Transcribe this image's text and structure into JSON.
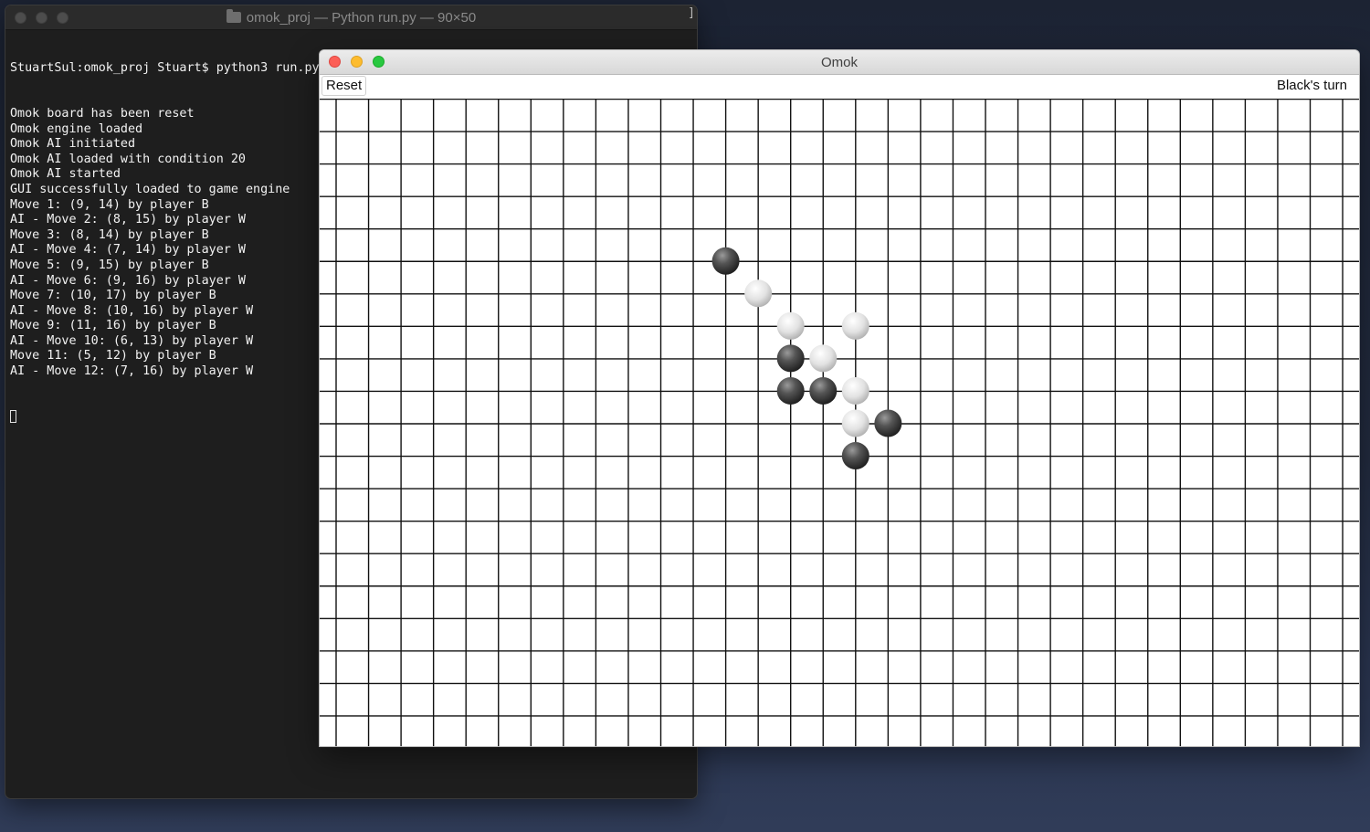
{
  "terminal": {
    "title": "omok_proj — Python run.py — 90×50",
    "prompt_line": "StuartSul:omok_proj Stuart$ python3 run.py",
    "output_lines": [
      "Omok board has been reset",
      "Omok engine loaded",
      "Omok AI initiated",
      "Omok AI loaded with condition 20",
      "Omok AI started",
      "GUI successfully loaded to game engine",
      "Move 1: (9, 14) by player B",
      "AI - Move 2: (8, 15) by player W",
      "Move 3: (8, 14) by player B",
      "AI - Move 4: (7, 14) by player W",
      "Move 5: (9, 15) by player B",
      "AI - Move 6: (9, 16) by player W",
      "Move 7: (10, 17) by player B",
      "AI - Move 8: (10, 16) by player W",
      "Move 9: (11, 16) by player B",
      "AI - Move 10: (6, 13) by player W",
      "Move 11: (5, 12) by player B",
      "AI - Move 12: (7, 16) by player W"
    ],
    "background": "#1e1e1e",
    "text_color": "#f2f2f2"
  },
  "omok": {
    "title": "Omok",
    "reset_label": "Reset",
    "turn_label": "Black's turn",
    "board": {
      "stones": [
        {
          "row": 5,
          "col": 12,
          "color": "black"
        },
        {
          "row": 6,
          "col": 13,
          "color": "white"
        },
        {
          "row": 7,
          "col": 14,
          "color": "white"
        },
        {
          "row": 7,
          "col": 16,
          "color": "white"
        },
        {
          "row": 8,
          "col": 14,
          "color": "black"
        },
        {
          "row": 8,
          "col": 15,
          "color": "white"
        },
        {
          "row": 9,
          "col": 14,
          "color": "black"
        },
        {
          "row": 9,
          "col": 15,
          "color": "black"
        },
        {
          "row": 9,
          "col": 16,
          "color": "white"
        },
        {
          "row": 10,
          "col": 16,
          "color": "white"
        },
        {
          "row": 10,
          "col": 17,
          "color": "black"
        },
        {
          "row": 11,
          "col": 16,
          "color": "black"
        }
      ]
    }
  },
  "colors": {
    "close": "#fc5f57",
    "minimize": "#fdbc2e",
    "zoom": "#28c840"
  }
}
